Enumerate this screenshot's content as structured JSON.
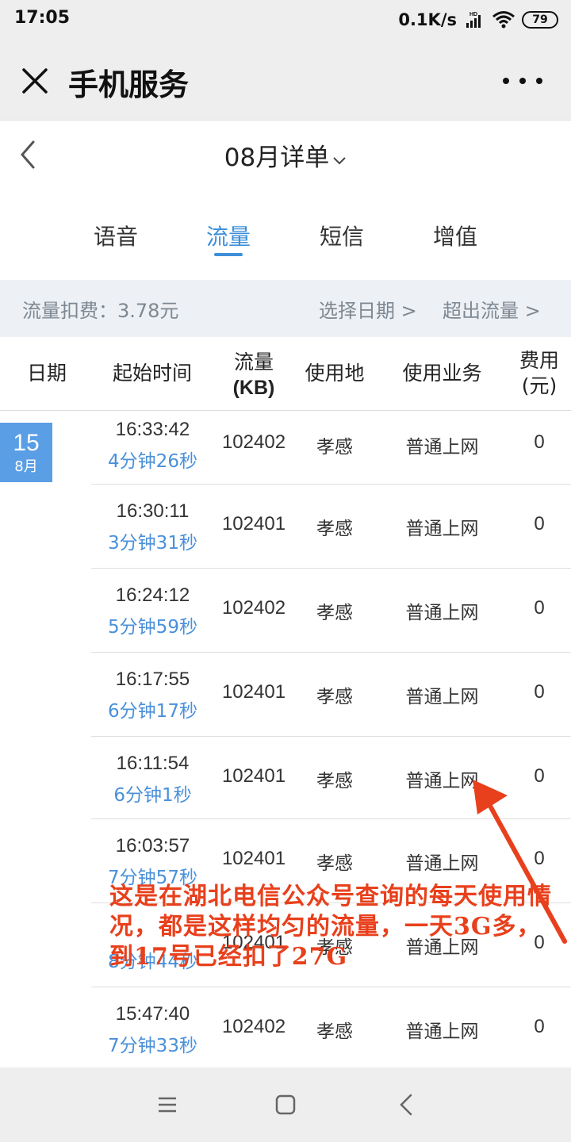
{
  "status_bar": {
    "time": "17:05",
    "net_speed": "0.1K/s",
    "battery": "79",
    "icons": [
      "hd-signal-icon",
      "wifi-icon",
      "battery-icon"
    ]
  },
  "title_bar": {
    "title": "手机服务",
    "close_icon": "close-icon",
    "more_icon": "more-icon"
  },
  "month_header": {
    "title": "08月详单",
    "chevron": "⌄"
  },
  "tabs": [
    {
      "label": "语音",
      "active": false
    },
    {
      "label": "流量",
      "active": true
    },
    {
      "label": "短信",
      "active": false
    },
    {
      "label": "增值",
      "active": false
    }
  ],
  "summary": {
    "fee_text": "流量扣费：3.78元",
    "select_date": "选择日期 >",
    "overflow": "超出流量 >"
  },
  "table": {
    "headers": {
      "date": "日期",
      "start_time": "起始时间",
      "traffic_line1": "流量",
      "traffic_line2": "(KB)",
      "location": "使用地",
      "business": "使用业务",
      "fee_line1": "费用",
      "fee_line2": "(元)"
    },
    "date_badge": {
      "day": "15",
      "month": "8月"
    },
    "rows": [
      {
        "time": "16:33:42",
        "duration": "4分钟26秒",
        "kb": "102402",
        "location": "孝感",
        "business": "普通上网",
        "fee": "0"
      },
      {
        "time": "16:30:11",
        "duration": "3分钟31秒",
        "kb": "102401",
        "location": "孝感",
        "business": "普通上网",
        "fee": "0"
      },
      {
        "time": "16:24:12",
        "duration": "5分钟59秒",
        "kb": "102402",
        "location": "孝感",
        "business": "普通上网",
        "fee": "0"
      },
      {
        "time": "16:17:55",
        "duration": "6分钟17秒",
        "kb": "102401",
        "location": "孝感",
        "business": "普通上网",
        "fee": "0"
      },
      {
        "time": "16:11:54",
        "duration": "6分钟1秒",
        "kb": "102401",
        "location": "孝感",
        "business": "普通上网",
        "fee": "0"
      },
      {
        "time": "16:03:57",
        "duration": "7分钟57秒",
        "kb": "102401",
        "location": "孝感",
        "business": "普通上网",
        "fee": "0"
      },
      {
        "time": "",
        "duration": "8分钟44秒",
        "kb": "102401",
        "location": "孝感",
        "business": "普通上网",
        "fee": "0"
      },
      {
        "time": "15:47:40",
        "duration": "7分钟33秒",
        "kb": "102402",
        "location": "孝感",
        "business": "普通上网",
        "fee": "0"
      }
    ]
  },
  "annotation": {
    "text": "这是在湖北电信公众号查询的每天使用情况，都是这样均匀的流量，一天3G多，到17号已经扣了27G",
    "color": "#e8401c"
  },
  "nav_bar": {
    "icons": [
      "menu-icon",
      "home-square-icon",
      "back-triangle-icon"
    ]
  },
  "colors": {
    "accent": "#3d8fd9",
    "duration": "#4a90d9",
    "date_badge": "#5a9ee6",
    "summary_bg": "#edf0f4"
  }
}
